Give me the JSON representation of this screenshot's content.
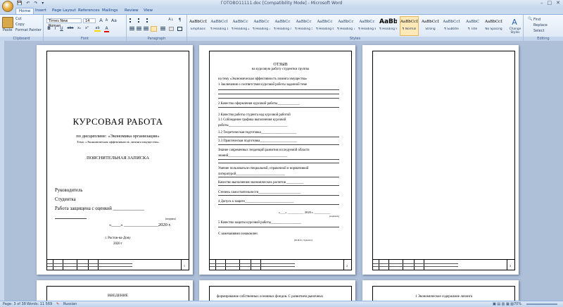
{
  "window": {
    "title": "ГОТОВО11111.doc [Compatibility Mode] - Microsoft Word",
    "controls": [
      "–",
      "□",
      "✕"
    ],
    "qat": "💾 ↶ ↷ ▾"
  },
  "tabs": [
    "Home",
    "Insert",
    "Page Layout",
    "References",
    "Mailings",
    "Review",
    "View"
  ],
  "ribbon": {
    "clipboard": {
      "paste": "Paste",
      "cut": "Cut",
      "copy": "Copy",
      "format_painter": "Format Painter",
      "label": "Clipboard"
    },
    "font": {
      "name": "Times New Roman",
      "size": "14",
      "label": "Font",
      "bold": "B",
      "italic": "I",
      "underline": "U",
      "strike": "abc",
      "sub": "x₂",
      "sup": "x²",
      "case": "Aa",
      "grow": "A",
      "shrink": "A",
      "color": "A",
      "highlight": "ab"
    },
    "paragraph": {
      "label": "Paragraph",
      "pilcrow": "¶",
      "sort": "A↓"
    },
    "styles": {
      "label": "Styles",
      "items": [
        {
          "sample": "AaBbCcDt",
          "name": "Emphasis"
        },
        {
          "sample": "AaBbCcI",
          "name": "¶ Heading 1"
        },
        {
          "sample": "AaBbCc",
          "name": "¶ Heading 2"
        },
        {
          "sample": "AaBbCc",
          "name": "¶ Heading 3"
        },
        {
          "sample": "AaBbCc",
          "name": "¶ Heading 4"
        },
        {
          "sample": "AaBbCc",
          "name": "¶ Heading 5"
        },
        {
          "sample": "AaBbCc",
          "name": "¶ Heading 6"
        },
        {
          "sample": "AaBbCc",
          "name": "¶ Heading 7"
        },
        {
          "sample": "AaBbCc",
          "name": "¶ Heading 8"
        },
        {
          "sample": "AaBb",
          "name": "¶ Heading 9"
        },
        {
          "sample": "AaBbCcDc",
          "name": "¶ Normal"
        },
        {
          "sample": "AaBbCcDc",
          "name": "Strong"
        },
        {
          "sample": "AaBbCcI",
          "name": "¶ Subtitle"
        },
        {
          "sample": "AaBbC",
          "name": "¶ Title"
        },
        {
          "sample": "AaBbCcDc",
          "name": "No Spacing"
        }
      ],
      "change_styles": "Change Styles"
    },
    "editing": {
      "find": "Find",
      "replace": "Replace",
      "select": "Select",
      "label": "Editing"
    }
  },
  "page1": {
    "title": "КУРСОВАЯ  РАБОТА",
    "discipline": "по дисциплине: «Экономика организации»",
    "topic": "Тема: «Экономическая эффективность лизинга имущества»",
    "note": "ПОЯСНИТЕЛЬНАЯ ЗАПИСКА",
    "supervisor": "Руководитель",
    "student": "Студентка",
    "defended": "Работа защищена с оценкой _____________",
    "signature": "(подпись)",
    "date": "«____» _______________2020 г.",
    "city": "г. Ростов-на-Дону",
    "year": "2020 г",
    "page_num": "1"
  },
  "page2": {
    "title": "ОТЗЫВ",
    "subtitle": "на курсовую работу студентки группы",
    "topic": "на тему «Экономическая эффективность лизинга имущества»",
    "items": [
      "1 Заключение о соответствии курсовой работы заданной теме",
      "2 Качество оформления курсовой работы_____________",
      "3 Качество работы студента над курсовой работой",
      "3.1 Соблюдение графика выполнения курсовой",
      "работы___________________________________",
      "3.2 Теоретическая подготовка_____________________",
      "3.3 Практическая подготовка______________________",
      "Знание современных тенденций развития исследуемой области",
      "знаний___________________________________",
      "Умение пользоваться специальной, справочной и нормативной",
      "литературой_____________________________",
      "Качество выполнения экономических расчетов __________",
      "Степень самостоятельности_________________________",
      "4 Допуск к защите_____________________________",
      "«___» __________ 2020 г. __________",
      "(подпись)",
      "5 Качество защиты курсовой работы__________________",
      "С замечаниями ознакомлен",
      "(Ф.И.О. студента)"
    ],
    "page_num": "2"
  },
  "page3": {
    "page_num": "3"
  },
  "bottom_pages": {
    "left": "ВВЕДЕНИЕ",
    "middle": "формирование собственных основных фондов. С развитием рыночных",
    "right": "1 Экономическое содержание лизинга"
  },
  "status": {
    "page": "Page: 3 of 38",
    "words": "Words: 11 569",
    "language": "Russian",
    "zoom": "70%"
  }
}
